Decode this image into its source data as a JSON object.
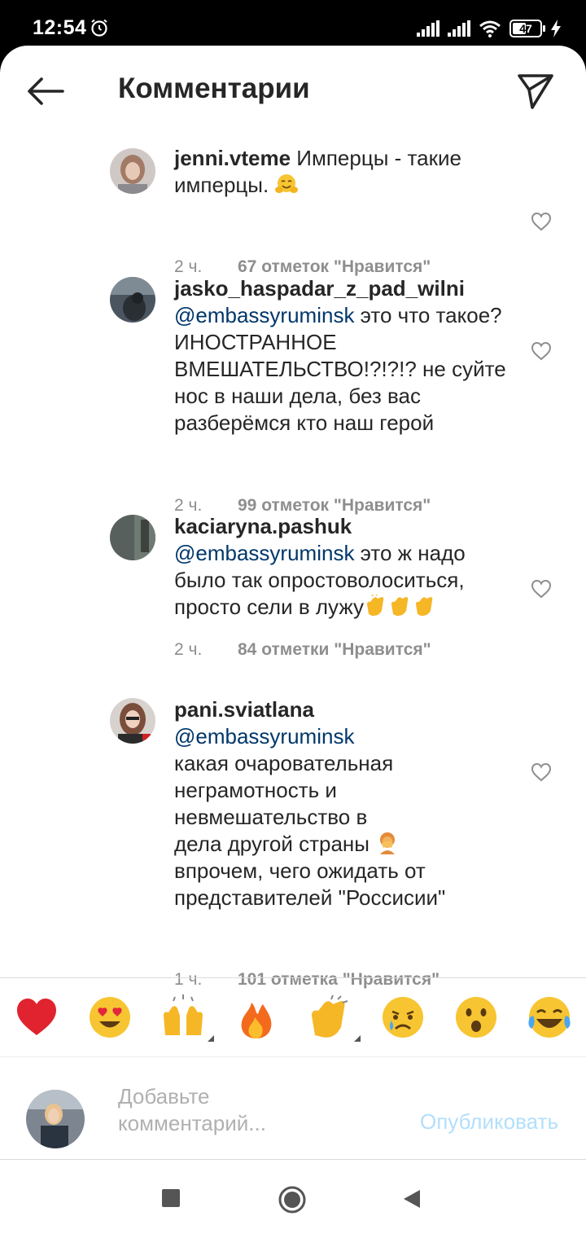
{
  "status_bar": {
    "time": "12:54",
    "battery": "47",
    "icons": [
      "alarm-icon",
      "signal-icon",
      "signal-icon",
      "wifi-icon",
      "battery-icon",
      "charging-icon"
    ]
  },
  "header": {
    "title": "Комментарии",
    "back_icon": "arrow-left-icon",
    "share_icon": "paper-plane-icon"
  },
  "comments": [
    {
      "username": "jenni.vteme",
      "mention": "",
      "text": " Имперцы - такие имперцы. ",
      "emoji": "hugging-face-emoji",
      "time": "2 ч.",
      "likes": "67 отметок \"Нравится\""
    },
    {
      "username": "jasko_haspadar_z_pad_wilni",
      "mention": "@embassyruminsk",
      "text": " это что такое? ИНОСТРАННОЕ ВМЕШАТЕЛЬСТВО!?!?!? не суйте нос в наши дела, без вас разберёмся кто наш герой",
      "time": "2 ч.",
      "likes": "99 отметок \"Нравится\""
    },
    {
      "username": "kaciaryna.pashuk",
      "mention": "@embassyruminsk",
      "text": " это ж надо было так опростоволоситься, просто сели в лужу",
      "emoji": "clapping-hands-emoji",
      "time": "2 ч.",
      "likes": "84 отметки \"Нравится\""
    },
    {
      "username": "pani.sviatlana",
      "mention": "@embassyruminsk",
      "text_lines": [
        "какая очаровательная",
        "неграмотность и",
        "невмешательство в",
        "дела другой страны ",
        "впрочем, чего ожидать от",
        "представителей \"Россисии\""
      ],
      "emoji": "facepalm-emoji",
      "time": "1 ч.",
      "likes": "101 отметка \"Нравится\""
    }
  ],
  "reactions": [
    "red-heart-emoji",
    "heart-eyes-emoji",
    "raising-hands-emoji",
    "fire-emoji",
    "clapping-hands-emoji",
    "crying-face-emoji",
    "astonished-face-emoji",
    "tears-of-joy-emoji"
  ],
  "input": {
    "placeholder_line1": "Добавьте",
    "placeholder_line2": "комментарий...",
    "post_label": "Опубликовать"
  },
  "colors": {
    "mention": "#00376b",
    "meta": "#8e8e8e",
    "post_disabled": "#b2dffc"
  }
}
